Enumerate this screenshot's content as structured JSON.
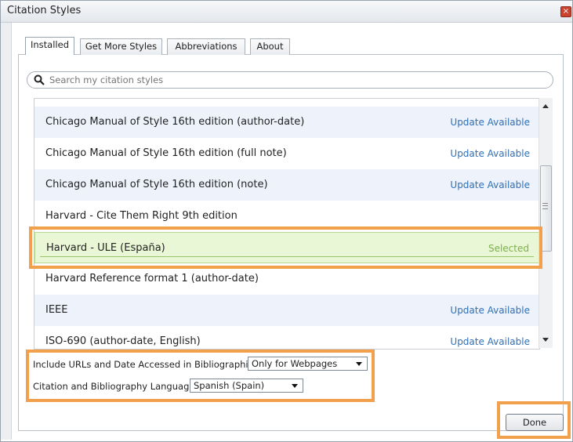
{
  "window": {
    "title": "Citation Styles",
    "close_glyph": "×"
  },
  "tabs": [
    {
      "label": "Installed"
    },
    {
      "label": "Get More Styles"
    },
    {
      "label": "Abbreviations"
    },
    {
      "label": "About"
    }
  ],
  "search": {
    "placeholder": "Search my citation styles",
    "icon": "search-icon"
  },
  "styles": [
    {
      "name": "Chicago Manual of Style 16th edition (author-date)",
      "status": "Update Available"
    },
    {
      "name": "Chicago Manual of Style 16th edition (full note)",
      "status": "Update Available"
    },
    {
      "name": "Chicago Manual of Style 16th edition (note)",
      "status": "Update Available"
    },
    {
      "name": "Harvard - Cite Them Right 9th edition",
      "status": ""
    },
    {
      "name": "Harvard - ULE (España)",
      "status": "Selected"
    },
    {
      "name": "Harvard Reference format 1 (author-date)",
      "status": ""
    },
    {
      "name": "IEEE",
      "status": "Update Available"
    },
    {
      "name": "ISO-690 (author-date, English)",
      "status": "Update Available"
    }
  ],
  "options": {
    "urls_label": "Include URLs and Date Accessed in Bibliographies:",
    "urls_value": "Only for Webpages",
    "language_label": "Citation and Bibliography Language:",
    "language_value": "Spanish (Spain)"
  },
  "buttons": {
    "done": "Done"
  },
  "colors": {
    "highlight": "#f2a04c",
    "link": "#2f6fb5",
    "selected_bg": "#eaf7d6"
  }
}
